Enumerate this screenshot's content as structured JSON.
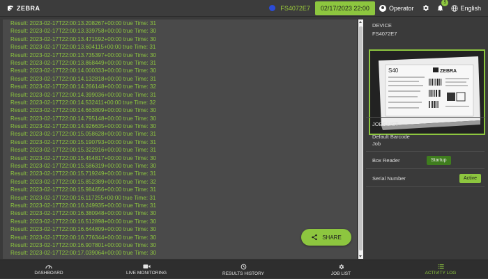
{
  "header": {
    "brand": "ZEBRA",
    "device_id": "FS4072E7",
    "datetime": "02/17/2023 22:00",
    "user": "Operator",
    "notification_count": "5",
    "language": "English"
  },
  "log": {
    "lines": [
      "Result: 2023-02-17T22:00:13.208267+00:00 true Time: 31",
      "Result: 2023-02-17T22:00:13.339758+00:00 true Time: 30",
      "Result: 2023-02-17T22:00:13.471592+00:00 true Time: 30",
      "Result: 2023-02-17T22:00:13.604115+00:00 true Time: 31",
      "Result: 2023-02-17T22:00:13.735397+00:00 true Time: 30",
      "Result: 2023-02-17T22:00:13.868449+00:00 true Time: 31",
      "Result: 2023-02-17T22:00:14.000333+00:00 true Time: 30",
      "Result: 2023-02-17T22:00:14.132818+00:00 true Time: 31",
      "Result: 2023-02-17T22:00:14.266148+00:00 true Time: 32",
      "Result: 2023-02-17T22:00:14.399036+00:00 true Time: 31",
      "Result: 2023-02-17T22:00:14.532411+00:00 true Time: 32",
      "Result: 2023-02-17T22:00:14.663809+00:00 true Time: 30",
      "Result: 2023-02-17T22:00:14.795148+00:00 true Time: 30",
      "Result: 2023-02-17T22:00:14.926635+00:00 true Time: 30",
      "Result: 2023-02-17T22:00:15.058628+00:00 true Time: 31",
      "Result: 2023-02-17T22:00:15.190793+00:00 true Time: 31",
      "Result: 2023-02-17T22:00:15.322916+00:00 true Time: 31",
      "Result: 2023-02-17T22:00:15.454817+00:00 true Time: 30",
      "Result: 2023-02-17T22:00:15.586319+00:00 true Time: 30",
      "Result: 2023-02-17T22:00:15.719249+00:00 true Time: 31",
      "Result: 2023-02-17T22:00:15.852389+00:00 true Time: 32",
      "Result: 2023-02-17T22:00:15.984656+00:00 true Time: 31",
      "Result: 2023-02-17T22:00:16.117255+00:00 true Time: 31",
      "Result: 2023-02-17T22:00:16.249935+00:00 true Time: 31",
      "Result: 2023-02-17T22:00:16.380948+00:00 true Time: 30",
      "Result: 2023-02-17T22:00:16.512898+00:00 true Time: 30",
      "Result: 2023-02-17T22:00:16.644809+00:00 true Time: 30",
      "Result: 2023-02-17T22:00:16.776344+00:00 true Time: 30",
      "Result: 2023-02-17T22:00:16.907801+00:00 true Time: 30",
      "Result: 2023-02-17T22:00:17.039064+00:00 true Time: 30"
    ]
  },
  "share_label": "SHARE",
  "device_panel": {
    "title": "DEVICE",
    "device_id": "FS4072E7",
    "label_model": "S40",
    "label_brand": "ZEBRA",
    "jobs_title": "JOBS LIST",
    "job_name_line1": "Default Barcode",
    "job_name_line2": "Job",
    "box_reader_label": "Box Reader",
    "box_reader_status": "Startup",
    "serial_number_label": "Serial Number",
    "serial_number_status": "Active"
  },
  "nav": {
    "tabs": [
      {
        "label": "DASHBOARD",
        "icon": "gauge-icon"
      },
      {
        "label": "LIVE MONITORING",
        "icon": "video-camera-icon"
      },
      {
        "label": "RESULTS HISTORY",
        "icon": "history-icon"
      },
      {
        "label": "JOB LIST",
        "icon": "gear-icon"
      },
      {
        "label": "ACTIVITY LOG",
        "icon": "list-icon"
      }
    ],
    "active_tab": "ACTIVITY LOG"
  },
  "colors": {
    "accent": "#8dc63f",
    "background": "#3a3a3a",
    "log_background": "#4a4a4a",
    "device_dot": "#2b4bd8"
  }
}
